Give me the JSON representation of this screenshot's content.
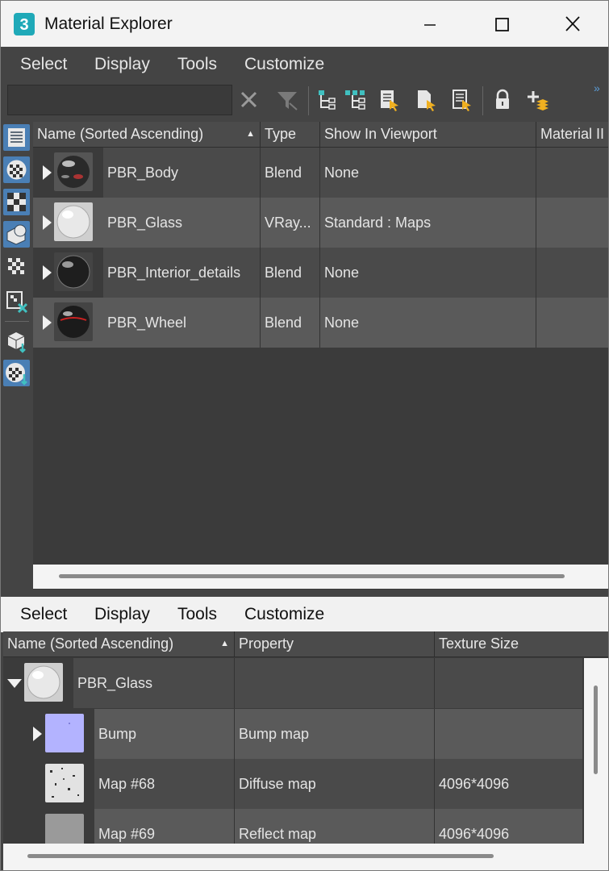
{
  "window": {
    "title": "Material Explorer",
    "app_icon_text": "3",
    "accent_color": "#1fa9b8"
  },
  "top_menu": [
    "Select",
    "Display",
    "Tools",
    "Customize"
  ],
  "toolbar": {
    "search_value": "",
    "icons": [
      "clear-x-icon",
      "filter-icon",
      "tree-view-icon",
      "tree-view-alt-icon",
      "select-document-icon",
      "select-page-icon",
      "list-document-icon",
      "lock-icon",
      "add-layer-icon"
    ]
  },
  "sidebar_icons": [
    "list-view-icon",
    "material-sphere-icon",
    "checker-map-icon",
    "objects-icon",
    "small-checker-icon",
    "map-missing-icon",
    "scene-object-icon",
    "material-download-icon"
  ],
  "upper": {
    "columns": [
      "Name (Sorted Ascending)",
      "Type",
      "Show In Viewport",
      "Material II"
    ],
    "rows": [
      {
        "name": "PBR_Body",
        "type": "Blend",
        "viewport": "None"
      },
      {
        "name": "PBR_Glass",
        "type": "VRay...",
        "viewport": "Standard : Maps"
      },
      {
        "name": "PBR_Interior_details",
        "type": "Blend",
        "viewport": "None"
      },
      {
        "name": "PBR_Wheel",
        "type": "Blend",
        "viewport": "None"
      }
    ]
  },
  "bottom_menu": [
    "Select",
    "Display",
    "Tools",
    "Customize"
  ],
  "lower": {
    "columns": [
      "Name (Sorted Ascending)",
      "Property",
      "Texture Size"
    ],
    "parent": {
      "name": "PBR_Glass"
    },
    "rows": [
      {
        "name": "Bump",
        "property": "Bump map",
        "size": ""
      },
      {
        "name": "Map #68",
        "property": "Diffuse map",
        "size": "4096*4096"
      },
      {
        "name": "Map #69",
        "property": "Reflect map",
        "size": "4096*4096"
      }
    ]
  }
}
